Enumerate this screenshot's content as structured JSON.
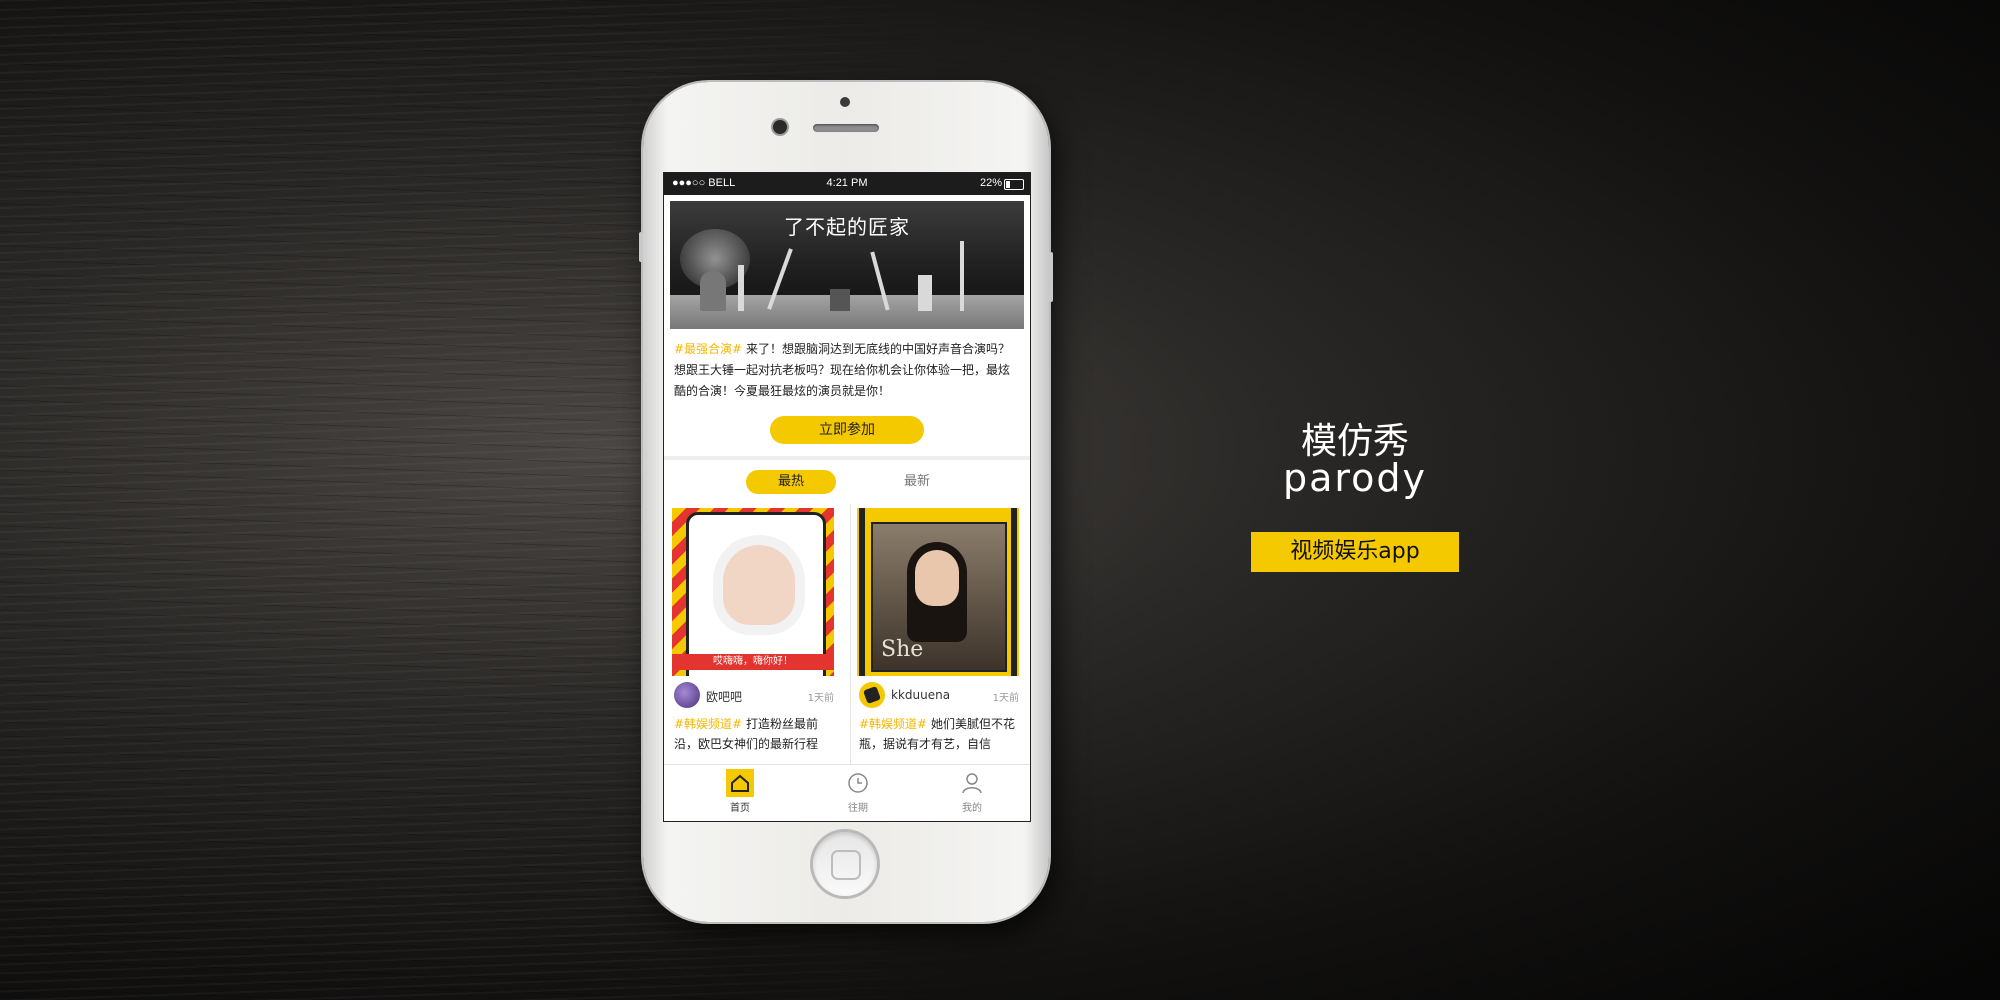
{
  "status_bar": {
    "carrier": "●●●○○ BELL",
    "time": "4:21 PM",
    "battery": "22%"
  },
  "banner": {
    "title": "了不起的匠家"
  },
  "promo": {
    "tag": "#最强合演#",
    "text": " 来了！想跟脑洞达到无底线的中国好声音合演吗？想跟王大锤一起对抗老板吗？现在给你机会让你体验一把，最炫酷的合演！今夏最狂最炫的演员就是你！",
    "join_label": "立即参加"
  },
  "feed_tabs": [
    "最热",
    "最新"
  ],
  "cards": [
    {
      "thumb_caption": "哎嗨嗨，嗨你好！",
      "user": "欧吧吧",
      "time": "1天前",
      "tag": "#韩娱频道#",
      "text": " 打造粉丝最前沿，欧巴女神们的最新行程"
    },
    {
      "thumb_caption": "She",
      "user": "kkduuena",
      "time": "1天前",
      "tag": "#韩娱频道#",
      "text": " 她们美腻但不花瓶，据说有才有艺，自信"
    }
  ],
  "tabbar": [
    "首页",
    "往期",
    "我的"
  ],
  "side": {
    "title_cn": "模仿秀",
    "title_en": "parody",
    "badge": "视频娱乐app"
  },
  "colors": {
    "accent": "#f5c900",
    "tag": "#f5b800",
    "background": "#121110"
  },
  "icons": [
    "home-icon",
    "clock-icon",
    "user-icon",
    "wifi-icon",
    "bluetooth-icon",
    "battery-icon"
  ]
}
